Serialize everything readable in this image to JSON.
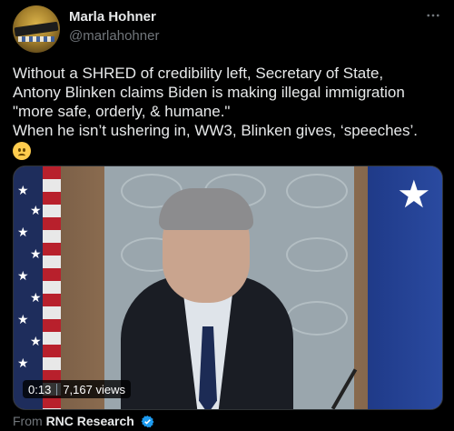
{
  "author": {
    "display_name": "Marla Hohner",
    "handle": "@marlahohner"
  },
  "more_icon": "more-horizontal-icon",
  "tweet": {
    "lines": [
      "Without a SHRED of credibility left, Secretary of State,",
      "Antony Blinken claims Biden is making illegal immigration",
      "\"more safe, orderly, & humane.\"",
      "When he isn’t ushering in, WW3, Blinken gives, ‘speeches’."
    ],
    "emoji": "confused-face-emoji"
  },
  "video": {
    "duration": "0:13",
    "views": "7,167 views"
  },
  "source": {
    "prefix": "From",
    "name": "RNC Research",
    "verified_color": "#1d9bf0"
  },
  "colors": {
    "background": "#000000",
    "primary_text": "#e7e9ea",
    "secondary_text": "#71767b"
  }
}
